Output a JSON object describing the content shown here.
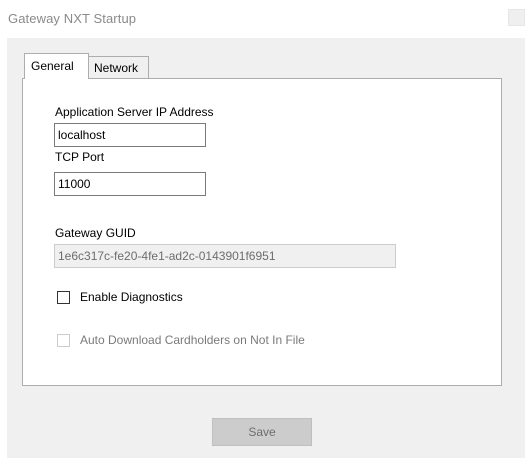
{
  "window": {
    "title": "Gateway NXT Startup"
  },
  "tabs": [
    {
      "label": "General",
      "selected": true
    },
    {
      "label": "Network",
      "selected": false
    }
  ],
  "general": {
    "app_server_ip": {
      "label": "Application Server IP Address",
      "value": "localhost"
    },
    "tcp_port": {
      "label": "TCP Port",
      "value": "11000"
    },
    "gateway_guid": {
      "label": "Gateway GUID",
      "value": "1e6c317c-fe20-4fe1-ad2c-0143901f6951",
      "enabled": false
    },
    "enable_diagnostics": {
      "label": "Enable Diagnostics",
      "checked": false,
      "enabled": true
    },
    "auto_download": {
      "label": "Auto Download Cardholders on Not In File",
      "checked": false,
      "enabled": false
    }
  },
  "footer": {
    "save_label": "Save",
    "save_enabled": false
  },
  "colors": {
    "dialog_background": "#f0f0f0",
    "panel_background": "#ffffff",
    "border": "#adadad",
    "disabled_text": "#7a7a7a"
  }
}
